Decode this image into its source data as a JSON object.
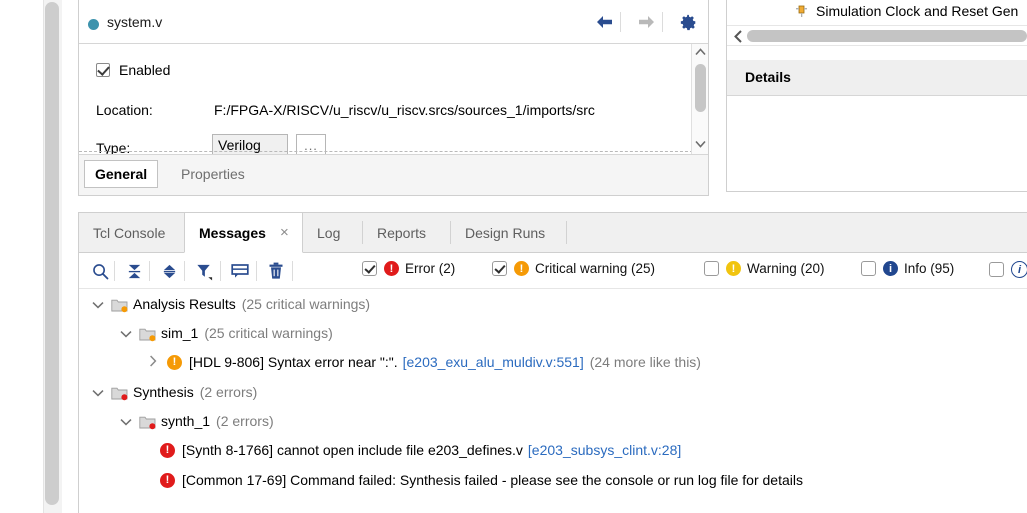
{
  "outer": {
    "scrollbar_name": "outer-vertical-scrollbar"
  },
  "source_properties": {
    "title": "system.v",
    "nav_back_icon": "arrow-left-icon",
    "nav_forward_icon": "arrow-right-icon",
    "settings_icon": "gear-icon",
    "enabled_label": "Enabled",
    "enabled_checked": true,
    "location_label": "Location:",
    "location_value": "F:/FPGA-X/RISCV/u_riscv/u_riscv.srcs/sources_1/imports/src",
    "type_label": "Type:",
    "type_value": "Verilog",
    "type_browse_label": "...",
    "tabs": [
      {
        "label": "General",
        "active": true
      },
      {
        "label": "Properties",
        "active": false
      }
    ]
  },
  "right_panel": {
    "tree_item": "Simulation Clock and Reset Gen",
    "tree_item_icon": "pin-component-icon",
    "hscroll_left_icon": "chevron-left-icon",
    "details_header": "Details"
  },
  "messages_dock": {
    "tabs": [
      {
        "label": "Tcl Console",
        "active": false,
        "closable": false
      },
      {
        "label": "Messages",
        "active": true,
        "closable": true,
        "close_label": "×"
      },
      {
        "label": "Log",
        "active": false,
        "closable": false
      },
      {
        "label": "Reports",
        "active": false,
        "closable": false
      },
      {
        "label": "Design Runs",
        "active": false,
        "closable": false
      }
    ],
    "toolbar_icons": [
      {
        "name": "search-icon"
      },
      {
        "name": "collapse-all-icon"
      },
      {
        "name": "expand-all-icon"
      },
      {
        "name": "filter-icon"
      },
      {
        "name": "message-balloon-icon"
      },
      {
        "name": "delete-trash-icon"
      }
    ],
    "filters": [
      {
        "label": "Error (2)",
        "checked": true,
        "icon": "error-icon",
        "color": "#e01b1b",
        "glyph": "!"
      },
      {
        "label": "Critical warning (25)",
        "checked": true,
        "icon": "critical-warning-icon",
        "color": "#f59a06",
        "glyph": "!"
      },
      {
        "label": "Warning (20)",
        "checked": false,
        "icon": "warning-icon",
        "color": "#f1c40f",
        "glyph": "!"
      },
      {
        "label": "Info (95)",
        "checked": false,
        "icon": "info-icon",
        "color": "#21478f",
        "glyph": "i"
      },
      {
        "label": "",
        "checked": false,
        "icon": "status-info-icon",
        "color": "#ffffff",
        "glyph": "i"
      }
    ],
    "tree": [
      {
        "indent": 0,
        "twisty": "expanded",
        "icon": "folder-warning-icon",
        "icon_badge": "#f59a06",
        "label": "Analysis Results",
        "suffix": "(25 critical warnings)",
        "severity": null,
        "link": null,
        "more": null
      },
      {
        "indent": 1,
        "twisty": "expanded",
        "icon": "folder-warning-icon",
        "icon_badge": "#f59a06",
        "label": "sim_1",
        "suffix": "(25 critical warnings)",
        "severity": null,
        "link": null,
        "more": null
      },
      {
        "indent": 2,
        "twisty": "collapsed",
        "icon": null,
        "icon_badge": null,
        "severity": {
          "color": "#f59a06",
          "glyph": "!",
          "name": "critical-warning-icon"
        },
        "label": "[HDL 9-806] Syntax error near \":\".",
        "link": "[e203_exu_alu_muldiv.v:551]",
        "more": "(24 more like this)",
        "suffix": null
      },
      {
        "indent": 0,
        "twisty": "expanded",
        "icon": "folder-error-icon",
        "icon_badge": "#e01b1b",
        "label": "Synthesis",
        "suffix": "(2 errors)",
        "severity": null,
        "link": null,
        "more": null
      },
      {
        "indent": 1,
        "twisty": "expanded",
        "icon": "folder-error-icon",
        "icon_badge": "#e01b1b",
        "label": "synth_1",
        "suffix": "(2 errors)",
        "severity": null,
        "link": null,
        "more": null
      },
      {
        "indent": 2,
        "twisty": null,
        "icon": null,
        "icon_badge": null,
        "severity": {
          "color": "#e01b1b",
          "glyph": "!",
          "name": "error-icon"
        },
        "label": "[Synth 8-1766] cannot open include file e203_defines.v",
        "link": "[e203_subsys_clint.v:28]",
        "more": null,
        "suffix": null
      },
      {
        "indent": 2,
        "twisty": null,
        "icon": null,
        "icon_badge": null,
        "severity": {
          "color": "#e01b1b",
          "glyph": "!",
          "name": "error-icon"
        },
        "label": "[Common 17-69] Command failed: Synthesis failed - please see the console or run log file for details",
        "link": null,
        "more": null,
        "suffix": null
      }
    ]
  }
}
